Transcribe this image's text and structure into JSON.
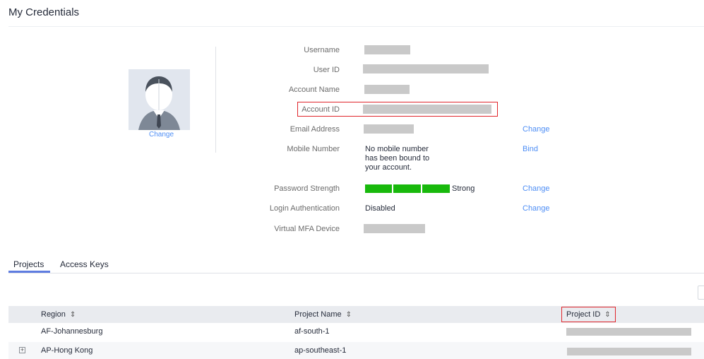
{
  "page": {
    "title": "My Credentials"
  },
  "avatar": {
    "change_label": "Change"
  },
  "fields": {
    "username_label": "Username",
    "user_id_label": "User ID",
    "account_name_label": "Account Name",
    "account_id_label": "Account ID",
    "email_label": "Email Address",
    "email_action": "Change",
    "mobile_label": "Mobile Number",
    "mobile_value_line1": "No mobile number",
    "mobile_value_line2": "has been bound to",
    "mobile_value_line3": "your account.",
    "mobile_action": "Bind",
    "password_strength_label": "Password Strength",
    "password_strength_value": "Strong",
    "password_strength_level": 3,
    "password_strength_max": 3,
    "password_action": "Change",
    "login_auth_label": "Login Authentication",
    "login_auth_value": "Disabled",
    "login_auth_action": "Change",
    "mfa_label": "Virtual MFA Device"
  },
  "tabs": [
    {
      "label": "Projects",
      "active": true
    },
    {
      "label": "Access Keys",
      "active": false
    }
  ],
  "table": {
    "columns": [
      {
        "label": "Region",
        "sort_icon": "⇕"
      },
      {
        "label": "Project Name",
        "sort_icon": "⇕"
      },
      {
        "label": "Project ID",
        "sort_icon": "⇕"
      }
    ],
    "rows": [
      {
        "region": "AF-Johannesburg",
        "project_name": "af-south-1"
      },
      {
        "region": "AP-Hong Kong",
        "project_name": "ap-southeast-1"
      }
    ],
    "expand_icon": "+"
  },
  "colors": {
    "accent": "#4e8ef5",
    "highlight": "#e0252b",
    "strength": "#18b90c"
  }
}
